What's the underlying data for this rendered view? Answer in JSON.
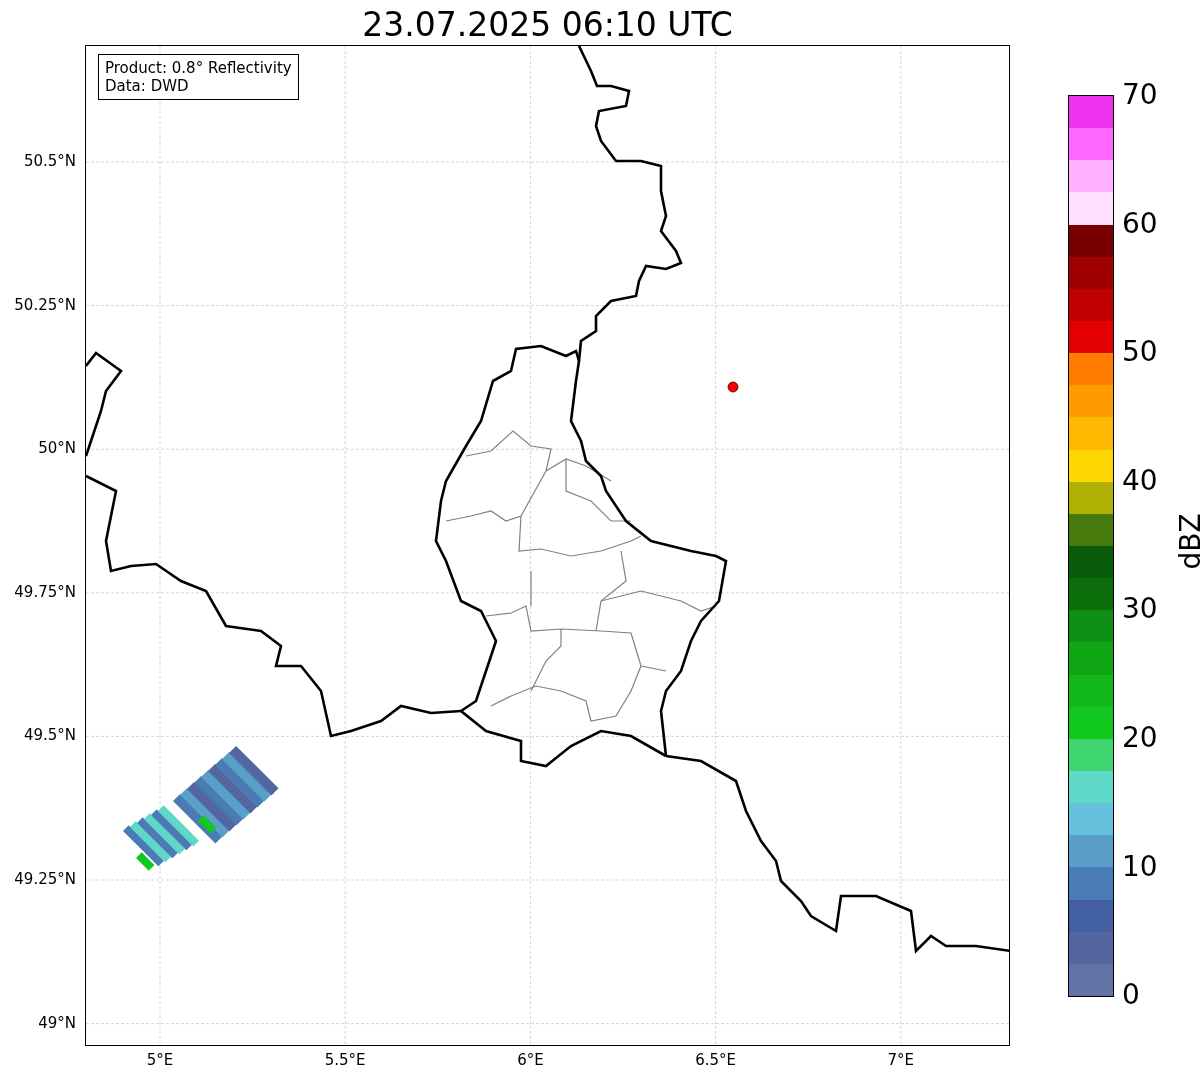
{
  "title": "23.07.2025 06:10 UTC",
  "info_box": {
    "lines": [
      "Product: 0.8° Reflectivity",
      "Data: DWD"
    ]
  },
  "map": {
    "y_ticks": [
      "50.5°N",
      "50.25°N",
      "50°N",
      "49.75°N",
      "49.5°N",
      "49.25°N",
      "49°N"
    ],
    "x_ticks": [
      "5°E",
      "5.5°E",
      "6°E",
      "6.5°E",
      "7°E"
    ]
  },
  "colorbar": {
    "label": "dBZ",
    "ticks": [
      "70",
      "60",
      "50",
      "40",
      "30",
      "20",
      "10",
      "0"
    ],
    "segments": [
      {
        "color": "#ee33ee"
      },
      {
        "color": "#ff66ff"
      },
      {
        "color": "#ffb0ff"
      },
      {
        "color": "#ffdfff"
      },
      {
        "color": "#780000"
      },
      {
        "color": "#a00000"
      },
      {
        "color": "#c00000"
      },
      {
        "color": "#e40000"
      },
      {
        "color": "#ff7c00"
      },
      {
        "color": "#ff9a00"
      },
      {
        "color": "#ffb800"
      },
      {
        "color": "#ffd700"
      },
      {
        "color": "#b0b004"
      },
      {
        "color": "#477a0c"
      },
      {
        "color": "#095c0c"
      },
      {
        "color": "#0b6e0b"
      },
      {
        "color": "#0e9014"
      },
      {
        "color": "#10a512"
      },
      {
        "color": "#12b81a"
      },
      {
        "color": "#10c81e"
      },
      {
        "color": "#3fd672"
      },
      {
        "color": "#5ed8c7"
      },
      {
        "color": "#66c2dc"
      },
      {
        "color": "#5a9fc7"
      },
      {
        "color": "#4a7bb5"
      },
      {
        "color": "#4460a4"
      },
      {
        "color": "#5466a0"
      },
      {
        "color": "#6474a6"
      }
    ]
  }
}
